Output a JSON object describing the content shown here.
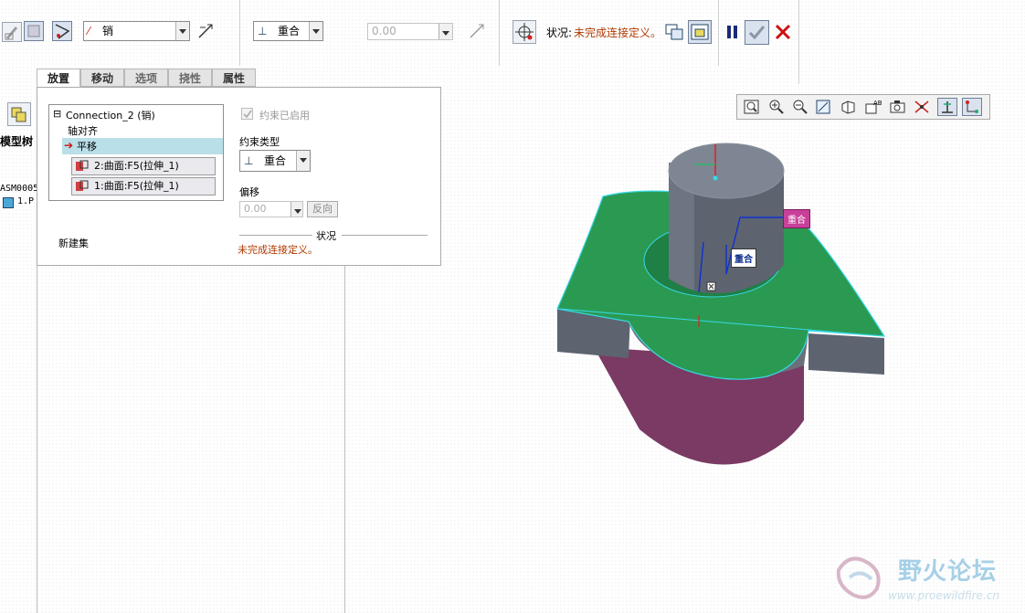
{
  "dashboard": {
    "connection_type": "销",
    "constraint_type": "重合",
    "offset_value": "0.00",
    "status_label": "状况:",
    "status_text": "未完成连接定义。"
  },
  "tabs": [
    {
      "label": "放置",
      "active": true
    },
    {
      "label": "移动",
      "active": false
    },
    {
      "label": "选项",
      "active": false
    },
    {
      "label": "挠性",
      "active": false
    },
    {
      "label": "属性",
      "active": false
    }
  ],
  "placement_panel": {
    "connection_name": "Connection_2 (销)",
    "tree_items": [
      "轴对齐",
      "平移"
    ],
    "references": [
      "2:曲面:F5(拉伸_1)",
      "1:曲面:F5(拉伸_1)"
    ],
    "new_set": "新建集",
    "constraint_enabled": "约束已启用",
    "constraint_type_label": "约束类型",
    "constraint_type_value": "重合",
    "offset_label": "偏移",
    "offset_value": "0.00",
    "flip_label": "反向",
    "status_title": "状况",
    "status_text": "未完成连接定义。"
  },
  "model_tree": {
    "title": "模型树",
    "items": [
      "ASM0005",
      "1.P"
    ]
  },
  "viewport": {
    "label_purple": "重合",
    "label_white": "重合",
    "watermark_cn": "野火论坛",
    "watermark_url": "www.proewildfire.cn"
  },
  "colors": {
    "status_red": "#b03a00",
    "green_surface": "#2a9a52",
    "gray_cylinder": "#747b88",
    "magenta_base": "#7a3a64",
    "cancel_red": "#cc1111",
    "pause_blue": "#1a2a7a"
  }
}
